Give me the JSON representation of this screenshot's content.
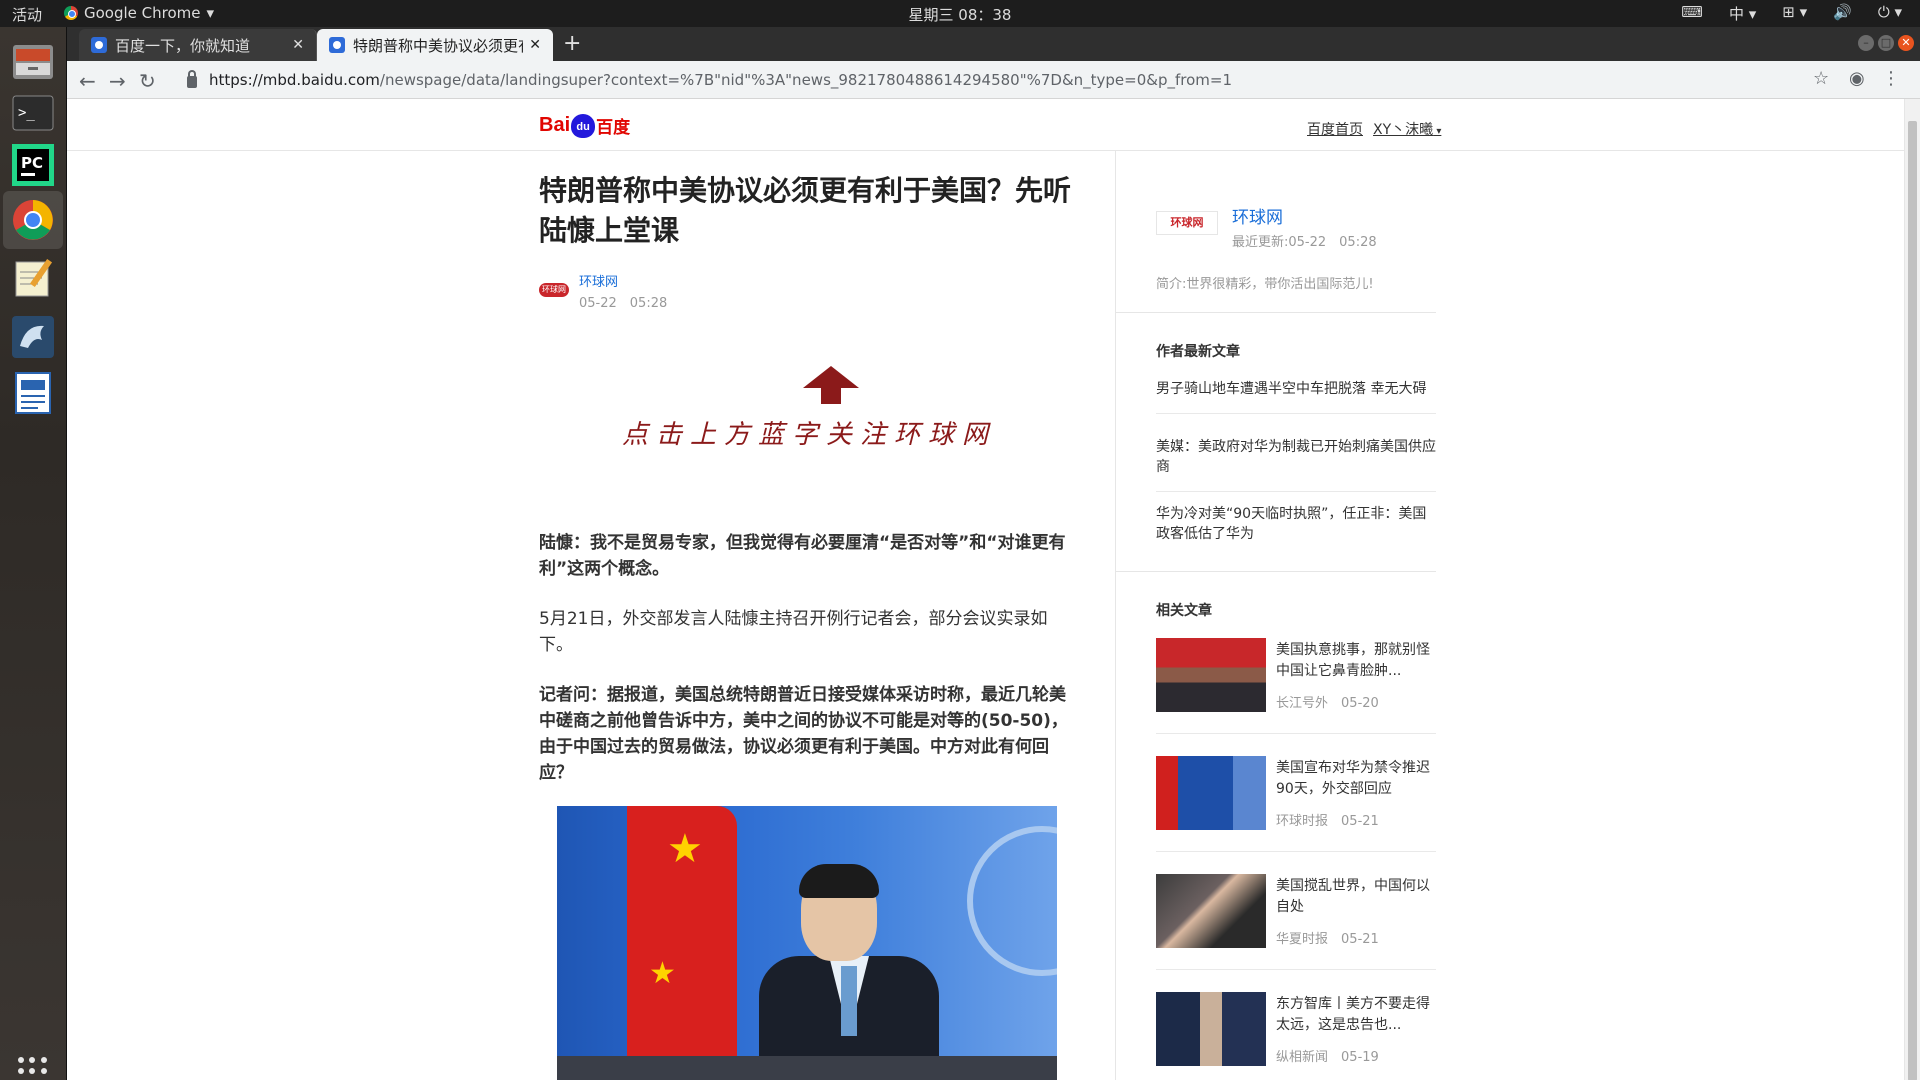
{
  "topbar": {
    "activities": "活动",
    "app_name": "Google Chrome",
    "clock": "星期三 08：38",
    "input_method": "中"
  },
  "dock": {
    "items": [
      {
        "name": "files",
        "icon": "file-cabinet-icon"
      },
      {
        "name": "terminal",
        "icon": "terminal-icon"
      },
      {
        "name": "pycharm",
        "icon": "pycharm-icon",
        "label": "PC"
      },
      {
        "name": "chrome",
        "icon": "chrome-icon"
      },
      {
        "name": "text-editor",
        "icon": "notepad-icon"
      },
      {
        "name": "mysql-workbench",
        "icon": "dolphin-icon"
      },
      {
        "name": "writer",
        "icon": "document-icon"
      }
    ]
  },
  "browser": {
    "tabs": [
      {
        "title": "百度一下，你就知道",
        "active": false
      },
      {
        "title": "特朗普称中美协议必须更有利于美国？先听陆慷上堂课",
        "active": true
      }
    ],
    "url_host": "https://mbd.baidu.com",
    "url_path": "/newspage/data/landingsuper?context=%7B\"nid\"%3A\"news_9821780488614294580\"%7D&n_type=0&p_from=1"
  },
  "header": {
    "logo_text": "Bai",
    "logo_paw": "du",
    "logo_cn": "百度",
    "home_link": "百度首页",
    "user_menu": "XY丶沫曦"
  },
  "article": {
    "title": "特朗普称中美协议必须更有利于美国？先听陆慷上堂课",
    "source": "环球网",
    "source_logo": "环球网",
    "time": "05-22　05:28",
    "banner_text": "点击上方蓝字关注环球网",
    "paragraphs": [
      "陆慷：我不是贸易专家，但我觉得有必要厘清“是否对等”和“对谁更有利”这两个概念。",
      "5月21日，外交部发言人陆慷主持召开例行记者会，部分会议实录如下。",
      "记者问：据报道，美国总统特朗普近日接受媒体采访时称，最近几轮美中磋商之前他曾告诉中方，美中之间的协议不可能是对等的(50-50)，由于中国过去的贸易做法，协议必须更有利于美国。中方对此有何回应？"
    ]
  },
  "sidebar": {
    "author": {
      "logo_text": "环球网",
      "name": "环球网",
      "updated": "最近更新:05-22　05:28",
      "description": "简介:世界很精彩，带你活出国际范儿!"
    },
    "latest_heading": "作者最新文章",
    "latest": [
      "男子骑山地车遭遇半空中车把脱落 幸无大碍",
      "美媒：美政府对华为制裁已开始刺痛美国供应商",
      "华为冷对美“90天临时执照”，任正非：美国政客低估了华为"
    ],
    "related_heading": "相关文章",
    "related": [
      {
        "title": "美国执意挑事，那就别怪中国让它鼻青脸肿...",
        "source": "长江号外",
        "date": "05-20"
      },
      {
        "title": "美国宣布对华为禁令推迟90天，外交部回应",
        "source": "环球时报",
        "date": "05-21"
      },
      {
        "title": "美国搅乱世界，中国何以自处",
        "source": "华夏时报",
        "date": "05-21"
      },
      {
        "title": "东方智库丨美方不要走得太远，这是忠告也...",
        "source": "纵相新闻",
        "date": "05-19"
      }
    ]
  }
}
